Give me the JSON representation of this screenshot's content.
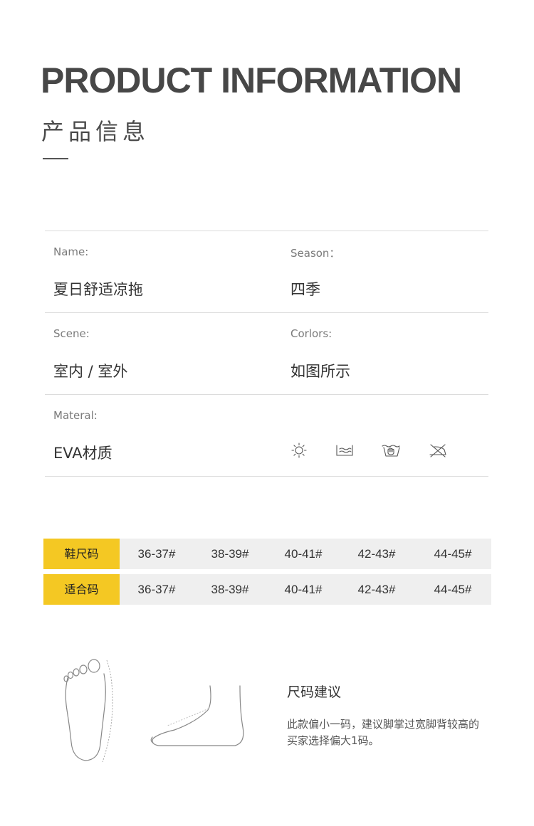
{
  "header": {
    "title_en": "PRODUCT INFORMATION",
    "title_cn": "产品信息"
  },
  "info": {
    "rows": [
      {
        "left": {
          "label": "Name:",
          "value": "夏日舒适凉拖"
        },
        "right": {
          "label": "Season：",
          "value": "四季"
        }
      },
      {
        "left": {
          "label": "Scene:",
          "value": "室内 / 室外"
        },
        "right": {
          "label": "Corlors:",
          "value": "如图所示"
        }
      },
      {
        "left": {
          "label": "Materal:",
          "value": "EVA材质"
        }
      }
    ],
    "care_icons": [
      "sun-dry-icon",
      "flat-dry-icon",
      "hand-wash-icon",
      "no-iron-icon"
    ]
  },
  "size_table": {
    "rows": [
      {
        "header": "鞋尺码",
        "cells": [
          "36-37#",
          "38-39#",
          "40-41#",
          "42-43#",
          "44-45#"
        ]
      },
      {
        "header": "适合码",
        "cells": [
          "36-37#",
          "38-39#",
          "40-41#",
          "42-43#",
          "44-45#"
        ]
      }
    ]
  },
  "advice": {
    "title": "尺码建议",
    "body": "此款偏小一码，建议脚掌过宽脚背较高的买家选择偏大1码。"
  },
  "colors": {
    "accent": "#f4c823",
    "row_bg": "#efefef",
    "divider": "#dcdcdc",
    "text_dark": "#333333",
    "text_muted": "#7a7a7a"
  }
}
